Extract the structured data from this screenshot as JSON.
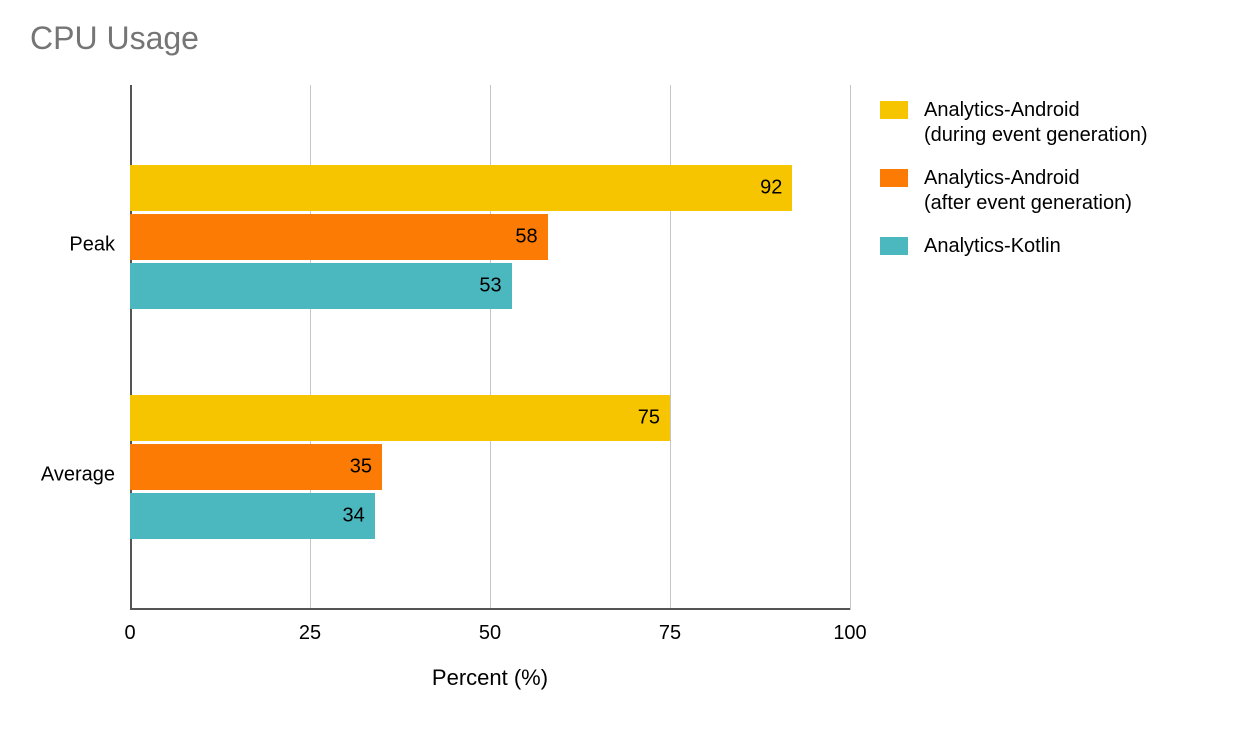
{
  "chart_data": {
    "type": "bar",
    "orientation": "horizontal",
    "title": "CPU Usage",
    "xlabel": "Percent (%)",
    "ylabel": "",
    "xlim": [
      0,
      100
    ],
    "x_ticks": [
      0,
      25,
      50,
      75,
      100
    ],
    "categories": [
      "Peak",
      "Average"
    ],
    "series": [
      {
        "name": "Analytics-Android\n(during event generation)",
        "values": [
          92,
          75
        ],
        "color": "#f7c500"
      },
      {
        "name": "Analytics-Android\n(after event generation)",
        "values": [
          58,
          35
        ],
        "color": "#fb7b04"
      },
      {
        "name": "Analytics-Kotlin",
        "values": [
          53,
          34
        ],
        "color": "#4bb8bf"
      }
    ],
    "legend_position": "right",
    "grid": true
  }
}
